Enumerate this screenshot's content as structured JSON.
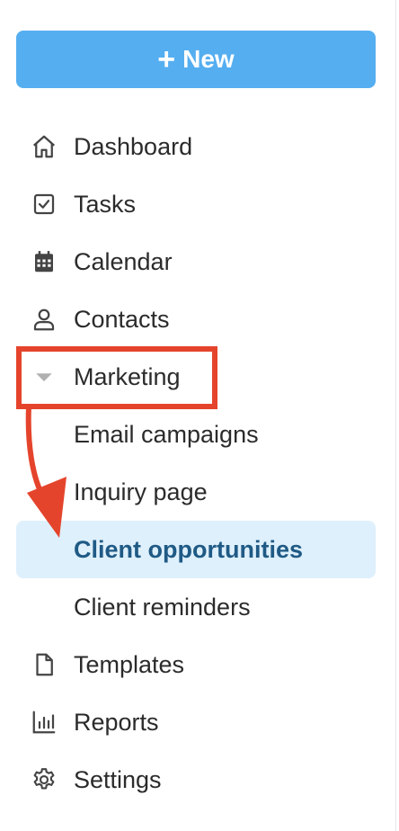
{
  "new_button": {
    "label": "New"
  },
  "nav": {
    "dashboard": "Dashboard",
    "tasks": "Tasks",
    "calendar": "Calendar",
    "contacts": "Contacts",
    "marketing": "Marketing",
    "templates": "Templates",
    "reports": "Reports",
    "settings": "Settings"
  },
  "marketing_sub": {
    "email_campaigns": "Email campaigns",
    "inquiry_page": "Inquiry page",
    "client_opportunities": "Client opportunities",
    "client_reminders": "Client reminders"
  },
  "annotation": {
    "color": "#e5442c"
  },
  "colors": {
    "primary_button": "#55aef0",
    "active_bg": "#def0fc",
    "active_text": "#1f5a85"
  },
  "icons": {
    "new": "plus-icon",
    "dashboard": "home-icon",
    "tasks": "checkbox-icon",
    "calendar": "calendar-icon",
    "contacts": "person-icon",
    "marketing": "caret-down-icon",
    "templates": "document-icon",
    "reports": "bar-chart-icon",
    "settings": "gear-icon"
  }
}
